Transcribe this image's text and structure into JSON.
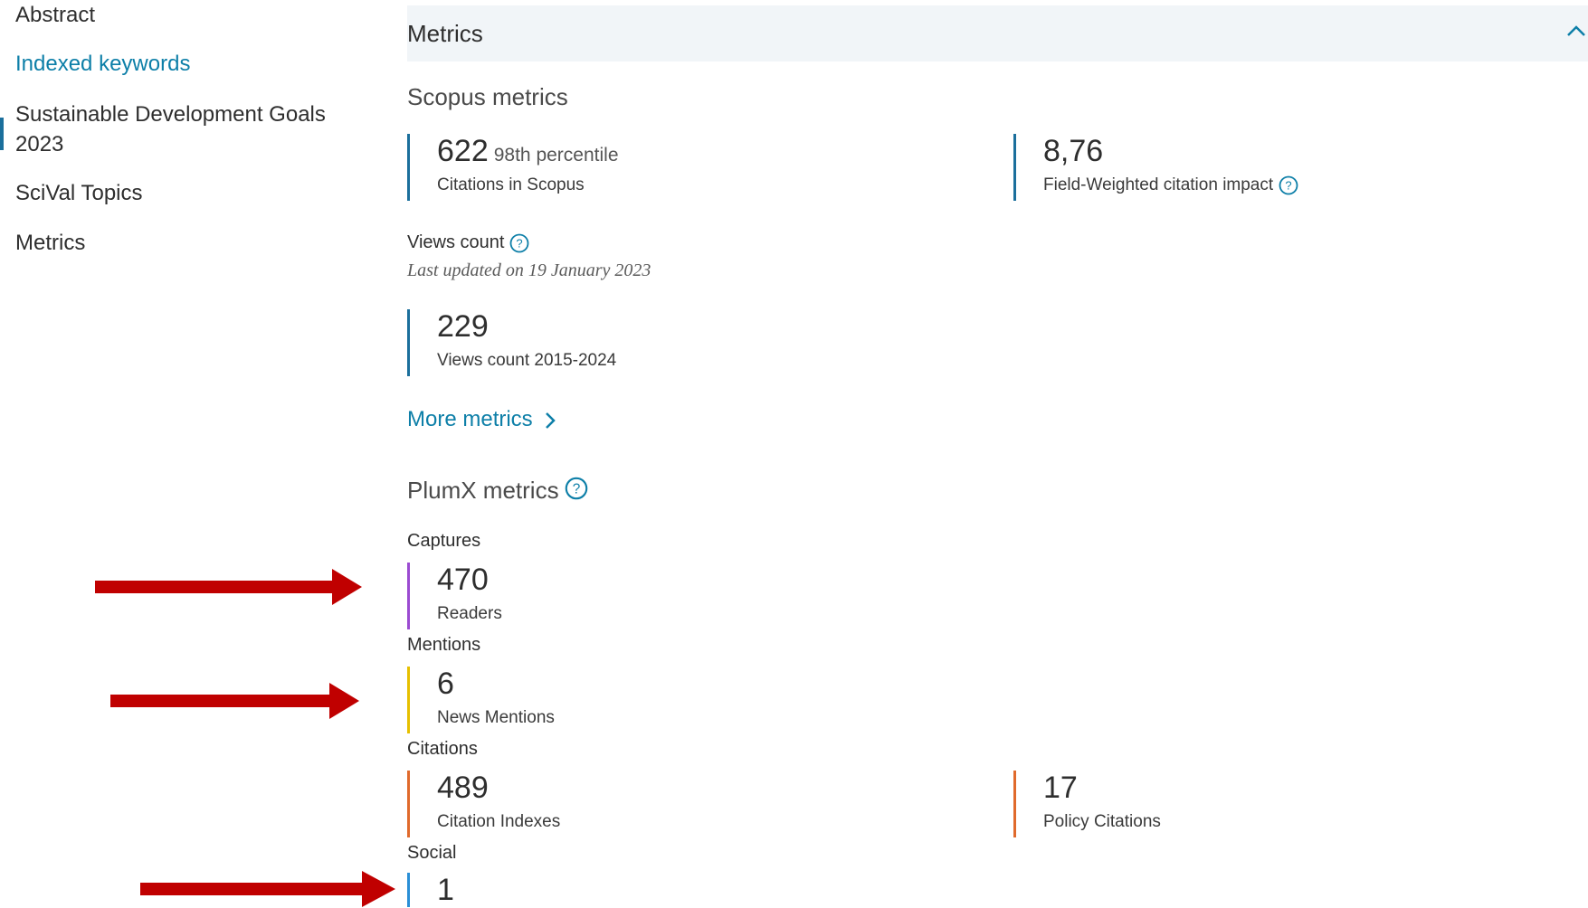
{
  "sidebar": {
    "items": [
      {
        "label": "Abstract"
      },
      {
        "label": "Indexed keywords"
      },
      {
        "label": "Sustainable Development Goals"
      },
      {
        "label": "2023"
      },
      {
        "label": "SciVal Topics"
      },
      {
        "label": "Metrics"
      }
    ]
  },
  "main": {
    "section_title": "Metrics",
    "scopus": {
      "heading": "Scopus metrics",
      "citations": {
        "value": "622",
        "percentile": "98th percentile",
        "label": "Citations in Scopus"
      },
      "fwci": {
        "value": "8,76",
        "label": "Field-Weighted citation impact"
      },
      "views_title": "Views count",
      "views_updated": "Last updated on 19 January 2023",
      "views": {
        "value": "229",
        "label": "Views count 2015-2024"
      },
      "more_link": "More metrics"
    },
    "plumx": {
      "heading": "PlumX metrics",
      "captures_title": "Captures",
      "readers": {
        "value": "470",
        "label": "Readers"
      },
      "mentions_title": "Mentions",
      "news": {
        "value": "6",
        "label": "News Mentions"
      },
      "citations_title": "Citations",
      "citation_indexes": {
        "value": "489",
        "label": "Citation Indexes"
      },
      "policy": {
        "value": "17",
        "label": "Policy Citations"
      },
      "social_title": "Social",
      "social": {
        "value": "1"
      }
    }
  },
  "colors": {
    "accent_link": "#0d7fa8",
    "scopus_bar": "#1b6f9c",
    "captures_bar": "#9b4bd1",
    "mentions_bar": "#e6c000",
    "citations_bar": "#e06a2c",
    "social_bar": "#2a8fd6",
    "annotation_arrow": "#c00000",
    "header_bg": "#f1f5f8"
  },
  "icons": {
    "help": "help-circle-icon",
    "collapse": "chevron-up-icon",
    "more": "chevron-right-icon",
    "annotation": "red-arrow-icon"
  }
}
